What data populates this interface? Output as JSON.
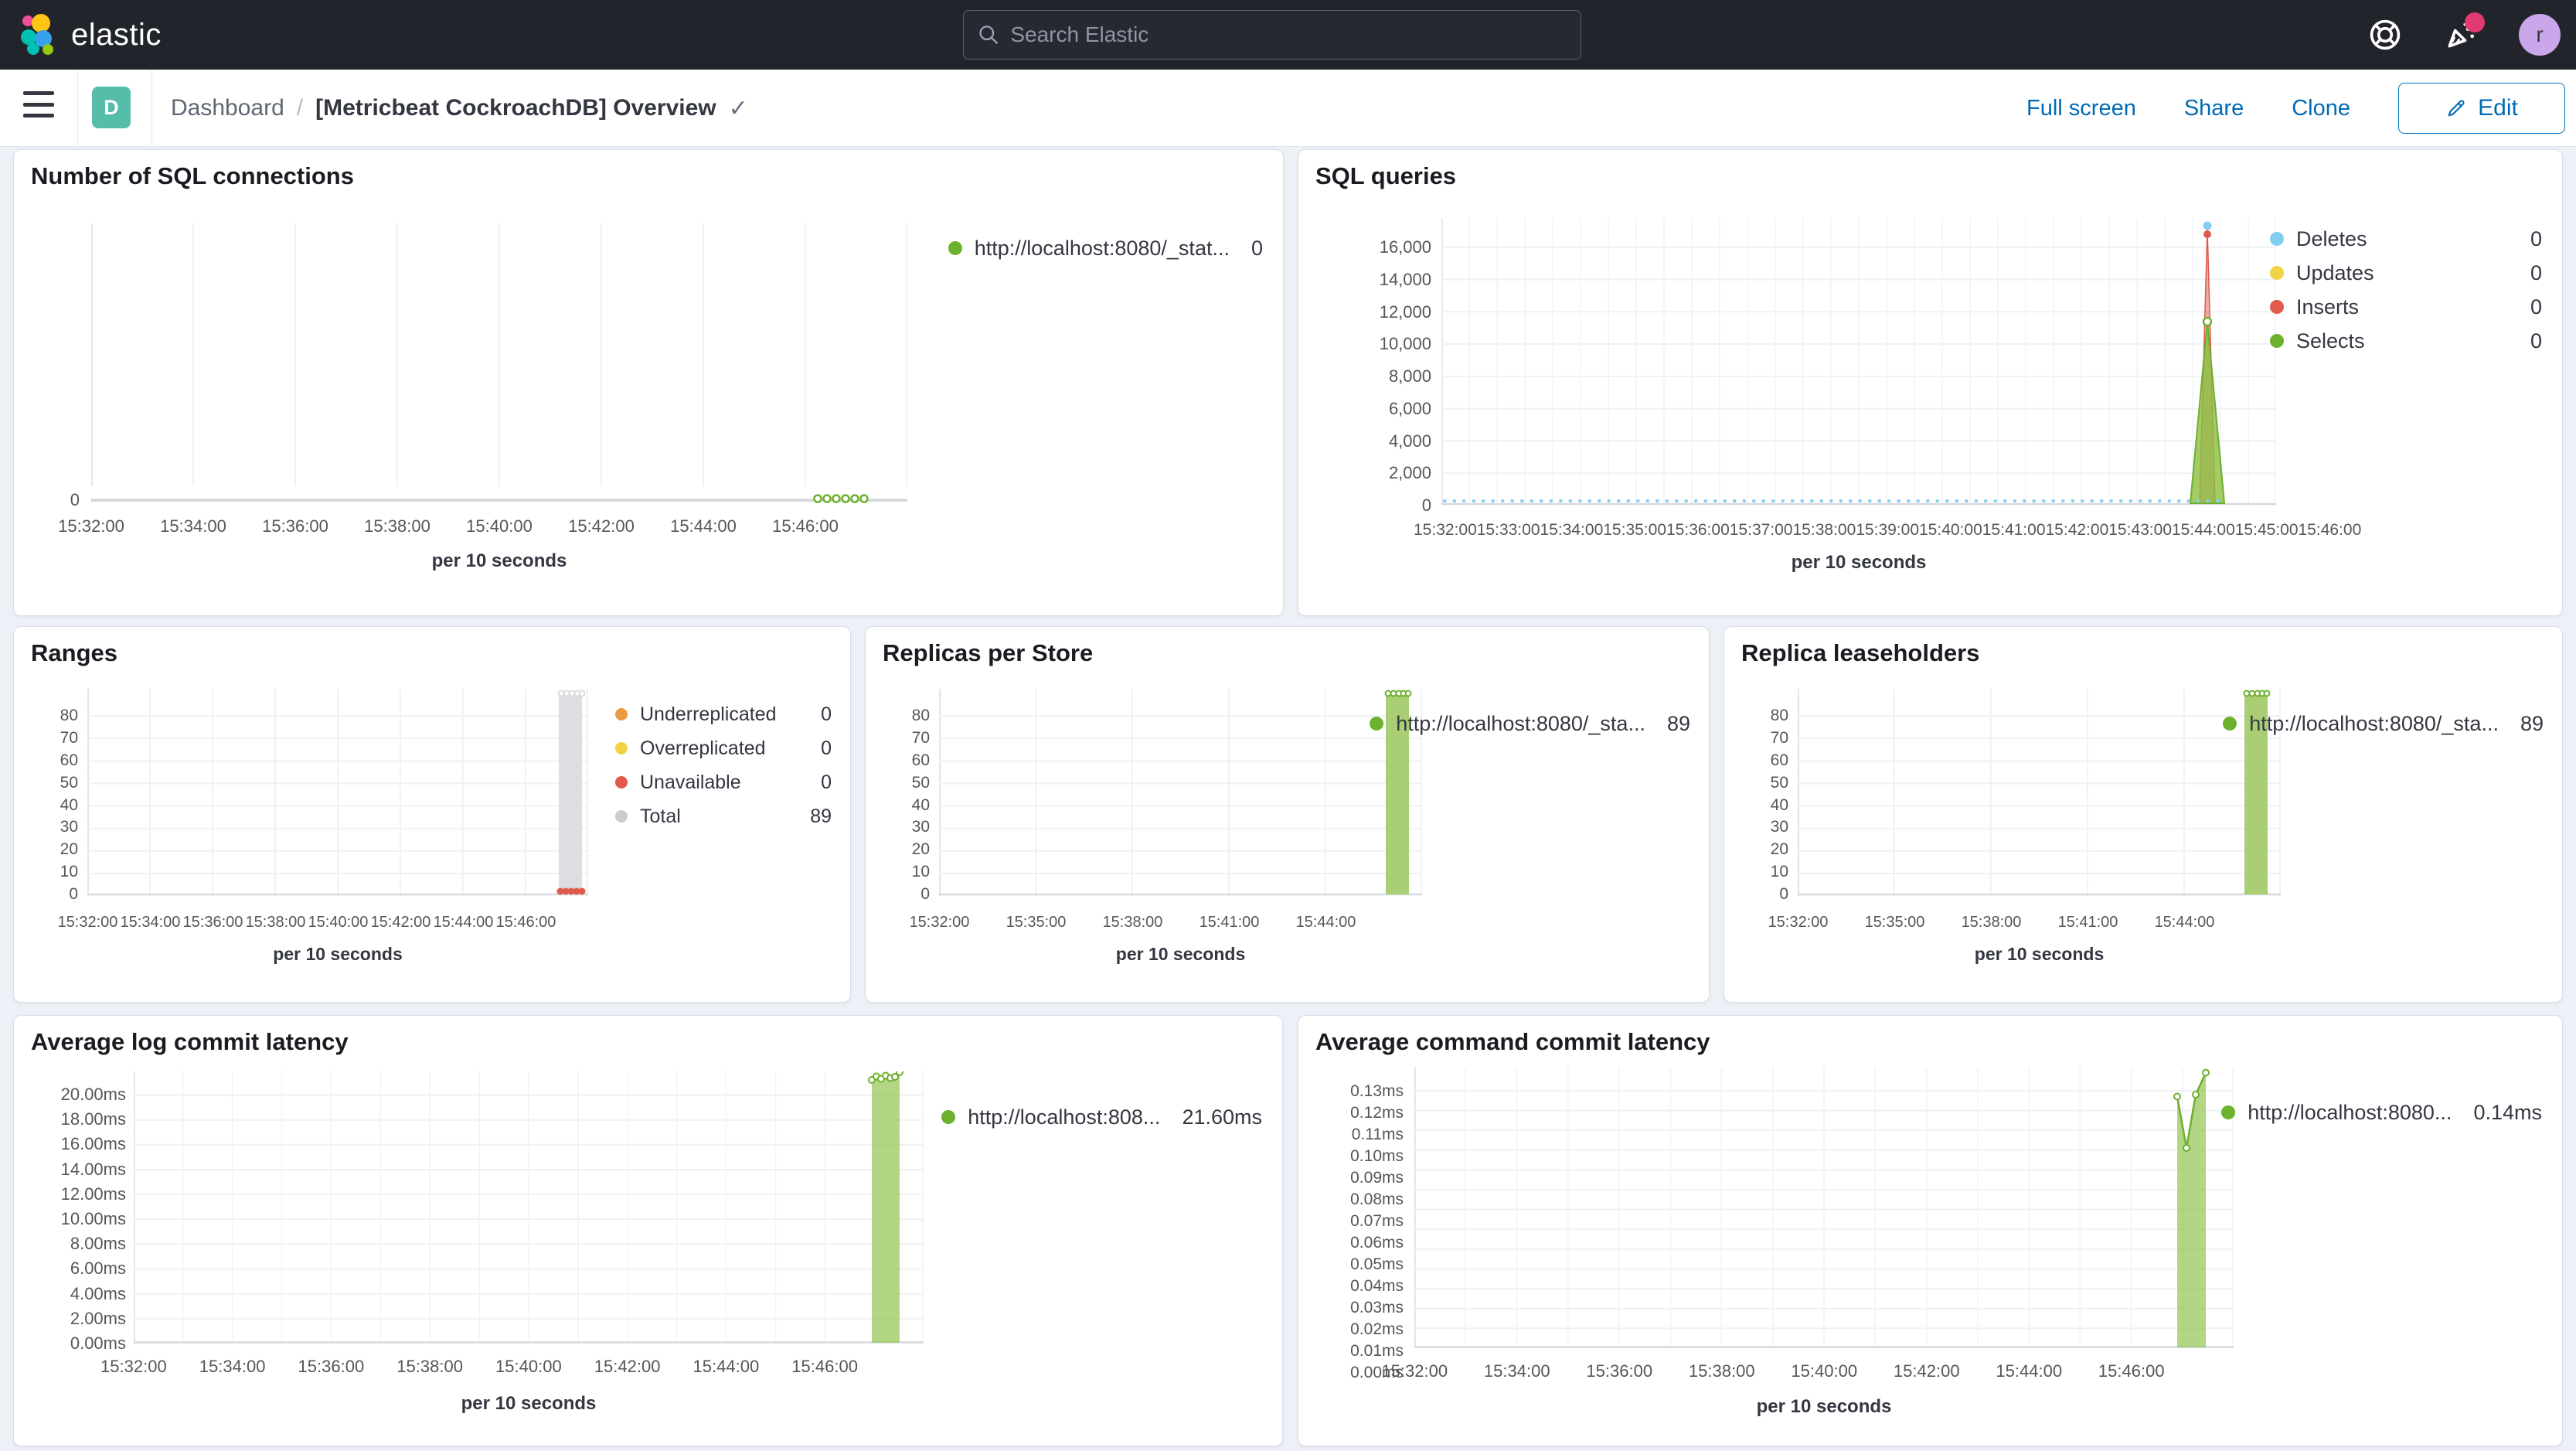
{
  "header": {
    "logo_text": "elastic",
    "search_placeholder": "Search Elastic",
    "avatar_initial": "r"
  },
  "toolbar": {
    "space_badge": "D",
    "breadcrumb_root": "Dashboard",
    "breadcrumb_separator": "/",
    "title": "[Metricbeat CockroachDB] Overview",
    "actions": {
      "full_screen": "Full screen",
      "share": "Share",
      "clone": "Clone",
      "edit": "Edit"
    }
  },
  "colors": {
    "primary_link": "#006BB4",
    "series_green": "#6DB22C",
    "series_light_blue": "#82CEF0",
    "series_yellow": "#F1D345",
    "series_red": "#E05B4C",
    "series_orange": "#EC9B41",
    "series_grey": "#C9CBD0",
    "badge_teal": "#55BDA9",
    "notification_pink": "#E23A72",
    "avatar_purple": "#C9A7EA"
  },
  "charts": {
    "sql_connections": {
      "title": "Number of SQL connections",
      "axis_title": "per 10 seconds",
      "yticks": [
        "0"
      ],
      "xticks": [
        "15:32:00",
        "15:34:00",
        "15:36:00",
        "15:38:00",
        "15:40:00",
        "15:42:00",
        "15:44:00",
        "15:46:00"
      ],
      "legend": [
        {
          "label": "http://localhost:8080/_stat...",
          "value": "0",
          "color": "#6DB22C"
        }
      ]
    },
    "sql_queries": {
      "title": "SQL queries",
      "axis_title": "per 10 seconds",
      "yticks": [
        "16,000",
        "14,000",
        "12,000",
        "10,000",
        "8,000",
        "6,000",
        "4,000",
        "2,000",
        "0"
      ],
      "xticks": [
        "15:32:00",
        "15:33:00",
        "15:34:00",
        "15:35:00",
        "15:36:00",
        "15:37:00",
        "15:38:00",
        "15:39:00",
        "15:40:00",
        "15:41:00",
        "15:42:00",
        "15:43:00",
        "15:44:00",
        "15:45:00",
        "15:46:00"
      ],
      "legend": [
        {
          "label": "Deletes",
          "value": "0",
          "color": "#82CEF0"
        },
        {
          "label": "Updates",
          "value": "0",
          "color": "#F1D345"
        },
        {
          "label": "Inserts",
          "value": "0",
          "color": "#E05B4C"
        },
        {
          "label": "Selects",
          "value": "0",
          "color": "#6DB22C"
        }
      ]
    },
    "ranges": {
      "title": "Ranges",
      "axis_title": "per 10 seconds",
      "yticks": [
        "80",
        "70",
        "60",
        "50",
        "40",
        "30",
        "20",
        "10",
        "0"
      ],
      "xticks": [
        "15:32:00",
        "15:34:00",
        "15:36:00",
        "15:38:00",
        "15:40:00",
        "15:42:00",
        "15:44:00",
        "15:46:00"
      ],
      "legend": [
        {
          "label": "Underreplicated",
          "value": "0",
          "color": "#EC9B41"
        },
        {
          "label": "Overreplicated",
          "value": "0",
          "color": "#F1D345"
        },
        {
          "label": "Unavailable",
          "value": "0",
          "color": "#E05B4C"
        },
        {
          "label": "Total",
          "value": "89",
          "color": "#C9CBD0"
        }
      ]
    },
    "replicas": {
      "title": "Replicas per Store",
      "axis_title": "per 10 seconds",
      "yticks": [
        "80",
        "70",
        "60",
        "50",
        "40",
        "30",
        "20",
        "10",
        "0"
      ],
      "xticks": [
        "15:32:00",
        "15:35:00",
        "15:38:00",
        "15:41:00",
        "15:44:00"
      ],
      "legend": [
        {
          "label": "http://localhost:8080/_sta...",
          "value": "89",
          "color": "#6DB22C"
        }
      ]
    },
    "leaseholders": {
      "title": "Replica leaseholders",
      "axis_title": "per 10 seconds",
      "yticks": [
        "80",
        "70",
        "60",
        "50",
        "40",
        "30",
        "20",
        "10",
        "0"
      ],
      "xticks": [
        "15:32:00",
        "15:35:00",
        "15:38:00",
        "15:41:00",
        "15:44:00"
      ],
      "legend": [
        {
          "label": "http://localhost:8080/_sta...",
          "value": "89",
          "color": "#6DB22C"
        }
      ]
    },
    "log_latency": {
      "title": "Average log commit latency",
      "axis_title": "per 10 seconds",
      "yticks": [
        "20.00ms",
        "18.00ms",
        "16.00ms",
        "14.00ms",
        "12.00ms",
        "10.00ms",
        "8.00ms",
        "6.00ms",
        "4.00ms",
        "2.00ms",
        "0.00ms"
      ],
      "xticks": [
        "15:32:00",
        "15:34:00",
        "15:36:00",
        "15:38:00",
        "15:40:00",
        "15:42:00",
        "15:44:00",
        "15:46:00"
      ],
      "legend": [
        {
          "label": "http://localhost:808...",
          "value": "21.60ms",
          "color": "#6DB22C"
        }
      ]
    },
    "cmd_latency": {
      "title": "Average command commit latency",
      "axis_title": "per 10 seconds",
      "yticks": [
        "0.13ms",
        "0.12ms",
        "0.11ms",
        "0.10ms",
        "0.09ms",
        "0.08ms",
        "0.07ms",
        "0.06ms",
        "0.05ms",
        "0.04ms",
        "0.03ms",
        "0.02ms",
        "0.01ms",
        "0.00ms"
      ],
      "xticks": [
        "15:32:00",
        "15:34:00",
        "15:36:00",
        "15:38:00",
        "15:40:00",
        "15:42:00",
        "15:44:00",
        "15:46:00"
      ],
      "legend": [
        {
          "label": "http://localhost:8080...",
          "value": "0.14ms",
          "color": "#6DB22C"
        }
      ]
    }
  },
  "chart_data": [
    {
      "type": "line",
      "title": "Number of SQL connections",
      "xlabel": "per 10 seconds",
      "x_range": [
        "15:32:00",
        "15:46:20"
      ],
      "series": [
        {
          "name": "http://localhost:8080/_stat...",
          "points_x": [
            "15:45:30",
            "15:45:40",
            "15:45:50",
            "15:46:00",
            "15:46:10",
            "15:46:20"
          ],
          "points_y": [
            0,
            0,
            0,
            0,
            0,
            0
          ],
          "current": 0
        }
      ],
      "ylim": [
        0,
        1
      ]
    },
    {
      "type": "area",
      "title": "SQL queries",
      "xlabel": "per 10 seconds",
      "x_range": [
        "15:32:00",
        "15:46:20"
      ],
      "ylim": [
        0,
        17800
      ],
      "series": [
        {
          "name": "Deletes",
          "current": 0,
          "spike_at": "15:45:50",
          "spike_value": 17600,
          "baseline": 0
        },
        {
          "name": "Updates",
          "current": 0,
          "spike_value": 0,
          "baseline": 0
        },
        {
          "name": "Inserts",
          "current": 0,
          "spike_at": "15:45:50",
          "spike_value": 17300,
          "baseline": 0
        },
        {
          "name": "Selects",
          "current": 0,
          "spike_at": "15:45:50",
          "spike_value": 11500,
          "baseline": 0
        }
      ]
    },
    {
      "type": "bar",
      "title": "Ranges",
      "xlabel": "per 10 seconds",
      "x_range": [
        "15:32:00",
        "15:46:20"
      ],
      "ylim": [
        0,
        92
      ],
      "series": [
        {
          "name": "Underreplicated",
          "current": 0
        },
        {
          "name": "Overreplicated",
          "current": 0
        },
        {
          "name": "Unavailable",
          "current": 0,
          "points_y": [
            0,
            0,
            0,
            0,
            0
          ]
        },
        {
          "name": "Total",
          "current": 89,
          "points_x": [
            "15:45:40",
            "15:45:50",
            "15:46:00",
            "15:46:10",
            "15:46:20"
          ],
          "points_y": [
            89,
            89,
            89,
            89,
            89
          ]
        }
      ]
    },
    {
      "type": "bar",
      "title": "Replicas per Store",
      "xlabel": "per 10 seconds",
      "ylim": [
        0,
        92
      ],
      "series": [
        {
          "name": "http://localhost:8080/_sta...",
          "current": 89,
          "points_x": [
            "15:45:40",
            "15:46:20"
          ],
          "points_y": [
            89,
            89
          ]
        }
      ]
    },
    {
      "type": "bar",
      "title": "Replica leaseholders",
      "xlabel": "per 10 seconds",
      "ylim": [
        0,
        92
      ],
      "series": [
        {
          "name": "http://localhost:8080/_sta...",
          "current": 89,
          "points_x": [
            "15:45:40",
            "15:46:20"
          ],
          "points_y": [
            89,
            89
          ]
        }
      ]
    },
    {
      "type": "area",
      "title": "Average log commit latency",
      "xlabel": "per 10 seconds",
      "ylim": [
        0,
        21.9
      ],
      "unit": "ms",
      "series": [
        {
          "name": "http://localhost:808...",
          "current": 21.6,
          "points_x": [
            "15:45:40",
            "15:45:50",
            "15:46:00",
            "15:46:10",
            "15:46:20",
            "15:46:30",
            "15:46:40"
          ],
          "points_y": [
            21.2,
            21.45,
            21.3,
            21.5,
            21.35,
            21.4,
            21.6
          ]
        }
      ]
    },
    {
      "type": "area",
      "title": "Average command commit latency",
      "xlabel": "per 10 seconds",
      "ylim": [
        0,
        0.142
      ],
      "unit": "ms",
      "series": [
        {
          "name": "http://localhost:8080...",
          "current": 0.14,
          "points_x": [
            "15:46:00",
            "15:46:10",
            "15:46:20",
            "15:46:30"
          ],
          "points_y": [
            0.127,
            0.101,
            0.128,
            0.138
          ]
        }
      ]
    }
  ]
}
